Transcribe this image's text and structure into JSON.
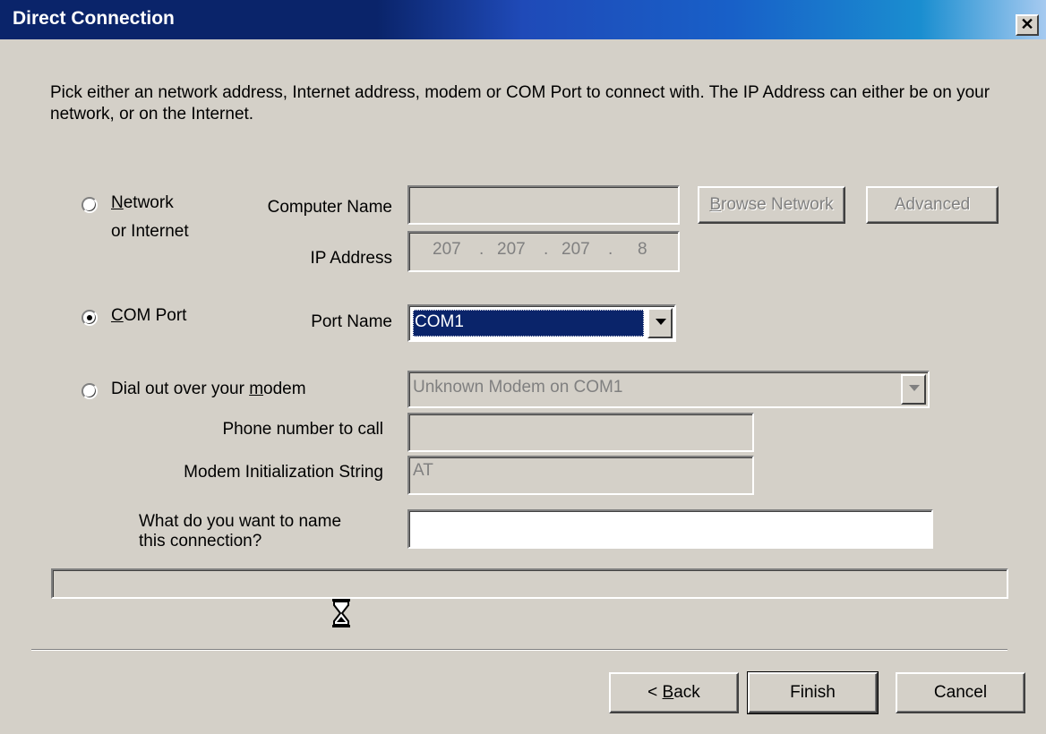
{
  "window": {
    "title": "Direct Connection",
    "close_glyph": "✕"
  },
  "description": "Pick either an network address, Internet address, modem or COM Port to connect with.  The IP Address can either be on your network, or on the Internet.",
  "network": {
    "radio_label_line1_pre": "N",
    "radio_label_line1_post": "etwork",
    "radio_label_line2": "or Internet",
    "computer_name_label": "Computer Name",
    "computer_name_value": "",
    "ip_label": "IP Address",
    "ip_octets": [
      "207",
      "207",
      "207",
      "8"
    ],
    "ip_sep": ".",
    "browse_button_pre": "B",
    "browse_button_post": "rowse Network",
    "advanced_button": "Advanced",
    "selected": false
  },
  "com": {
    "radio_label_pre": "C",
    "radio_label_post": "OM Port",
    "port_label": "Port Name",
    "port_value": "COM1",
    "selected": true
  },
  "modem": {
    "radio_label_pre": "Dial out over your ",
    "radio_label_ul": "m",
    "radio_label_post": "odem",
    "modem_value": "Unknown Modem on COM1",
    "phone_label": "Phone number to call",
    "phone_value": "",
    "init_label": "Modem Initialization String",
    "init_value": "AT",
    "selected": false
  },
  "name": {
    "label_line1": "What do you want to name",
    "label_line2": "this connection?",
    "value": ""
  },
  "progress": {
    "value": 0
  },
  "buttons": {
    "back_pre": "< ",
    "back_ul": "B",
    "back_post": "ack",
    "finish": "Finish",
    "cancel": "Cancel"
  },
  "colors": {
    "title_start": "#0a246a",
    "title_end": "#a6caf0",
    "face": "#d4d0c8",
    "highlight": "#0a246a"
  }
}
